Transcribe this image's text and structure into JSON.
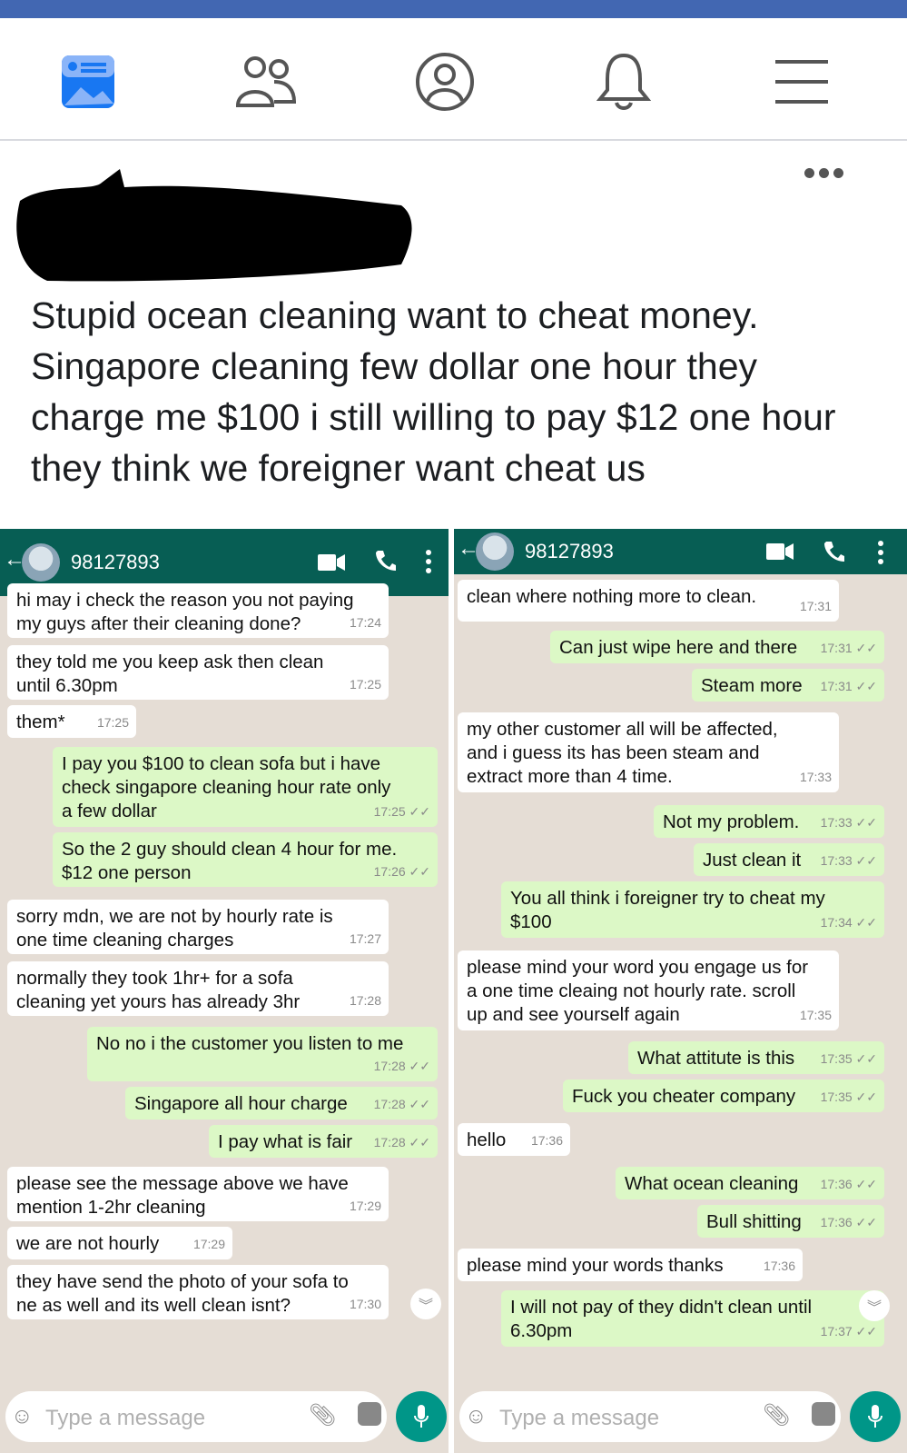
{
  "facebook": {
    "nav": [
      "news-feed-icon",
      "friends-icon",
      "profile-icon",
      "notifications-icon",
      "menu-icon"
    ],
    "post_text": "Stupid ocean cleaning want to cheat money. Singapore cleaning few dollar one hour they charge me $100 i still willing to pay $12 one hour they think we foreigner want cheat us"
  },
  "left_chat": {
    "contact": "98127893",
    "placeholder": "Type a message",
    "messages": [
      {
        "text": "hi may i check the reason you not paying\nmy guys after their cleaning done?",
        "time": "17:24"
      },
      {
        "text": "they told me you keep ask then clean\nuntil 6.30pm",
        "time": "17:25"
      },
      {
        "text": "them*",
        "time": "17:25"
      },
      {
        "text": "I pay you $100 to clean sofa but i have\ncheck singapore cleaning hour rate only\na few dollar",
        "time": "17:25 ✓✓"
      },
      {
        "text": "So the 2 guy should clean 4 hour for me.\n$12 one person",
        "time": "17:26 ✓✓"
      },
      {
        "text": "sorry mdn, we are not by hourly rate is\none time cleaning charges",
        "time": "17:27"
      },
      {
        "text": "normally they took 1hr+ for a sofa\ncleaning yet yours has already 3hr",
        "time": "17:28"
      },
      {
        "text": "No no i the customer you listen to me",
        "time": "17:28 ✓✓"
      },
      {
        "text": "Singapore all hour charge",
        "time": "17:28 ✓✓"
      },
      {
        "text": "I pay what is fair",
        "time": "17:28 ✓✓"
      },
      {
        "text": "please see the message above we have\nmention 1-2hr cleaning",
        "time": "17:29"
      },
      {
        "text": "we are not hourly",
        "time": "17:29"
      },
      {
        "text": "they have send the photo of your sofa to\nne as well and its well clean isnt?",
        "time": "17:30"
      }
    ]
  },
  "right_chat": {
    "contact": "98127893",
    "placeholder": "Type a message",
    "messages": [
      {
        "text": "clean where nothing more to clean.",
        "time": "17:31"
      },
      {
        "text": "Can just wipe here and there",
        "time": "17:31 ✓✓"
      },
      {
        "text": "Steam more",
        "time": "17:31 ✓✓"
      },
      {
        "text": "my other customer all will be affected,\nand i guess its has been steam and\nextract more than 4 time.",
        "time": "17:33"
      },
      {
        "text": "Not my problem.",
        "time": "17:33 ✓✓"
      },
      {
        "text": "Just clean it",
        "time": "17:33 ✓✓"
      },
      {
        "text": "You all think i foreigner try to cheat my\n$100",
        "time": "17:34 ✓✓"
      },
      {
        "text": "please mind your word you engage us for\na one time cleaing not hourly rate. scroll\nup and see yourself again",
        "time": "17:35"
      },
      {
        "text": "What attitute is this",
        "time": "17:35 ✓✓"
      },
      {
        "text": "Fuck you cheater company",
        "time": "17:35 ✓✓"
      },
      {
        "text": "hello",
        "time": "17:36"
      },
      {
        "text": "What ocean cleaning",
        "time": "17:36 ✓✓"
      },
      {
        "text": "Bull shitting",
        "time": "17:36 ✓✓"
      },
      {
        "text": "please mind your words thanks",
        "time": "17:36"
      },
      {
        "text": "I will not pay of they didn't clean until\n6.30pm",
        "time": "17:37 ✓✓"
      }
    ]
  }
}
